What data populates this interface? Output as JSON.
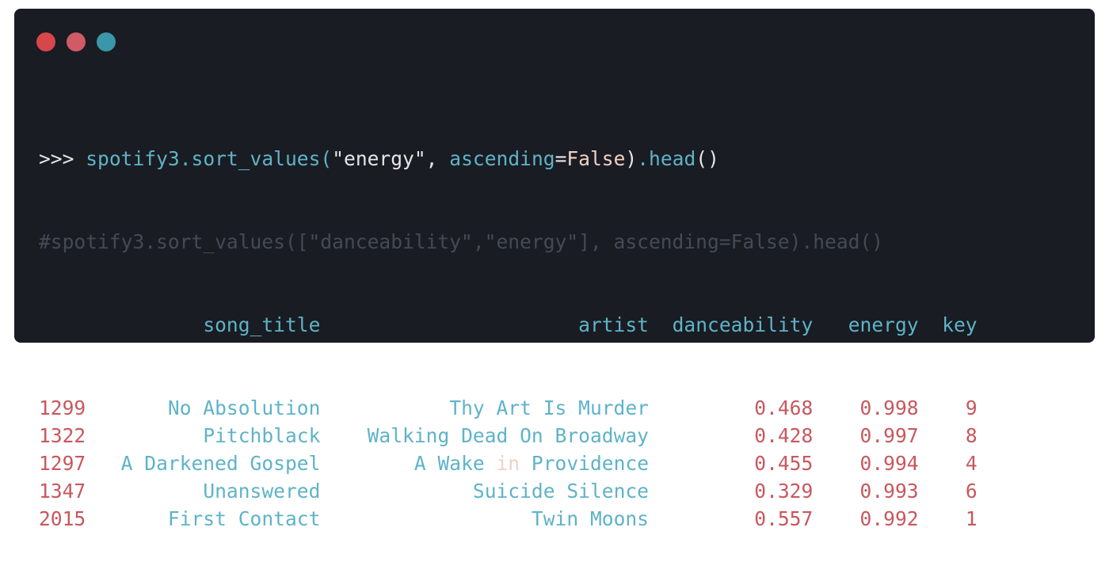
{
  "window": {
    "lights": [
      "close",
      "minimize",
      "maximize"
    ],
    "colors": {
      "close": "#d7474a",
      "minimize": "#d05a66",
      "maximize": "#3a96a8",
      "background": "#191c22"
    }
  },
  "command": {
    "prompt": ">>> ",
    "var": "spotify3",
    "method": ".sort_values(",
    "arg": "\"energy\"",
    "sep": ", ",
    "kwarg": "ascending",
    "eq": "=",
    "value": "False",
    "tail_paren": ")",
    "tail_method": ".head",
    "tail_call": "()"
  },
  "comment": "#spotify3.sort_values([\"danceability\",\"energy\"], ascending=False).head()",
  "table": {
    "columns": [
      "song_title",
      "artist",
      "danceability",
      "energy",
      "key"
    ],
    "rows": [
      {
        "index": "1299",
        "song_title": "No Absolution",
        "artist": "Thy Art Is Murder",
        "danceability": "0.468",
        "energy": "0.998",
        "key": "9"
      },
      {
        "index": "1322",
        "song_title": "Pitchblack",
        "artist": "Walking Dead On Broadway",
        "danceability": "0.428",
        "energy": "0.997",
        "key": "8"
      },
      {
        "index": "1297",
        "song_title": "A Darkened Gospel",
        "artist": "A Wake in Providence",
        "danceability": "0.455",
        "energy": "0.994",
        "key": "4"
      },
      {
        "index": "1347",
        "song_title": "Unanswered",
        "artist": "Suicide Silence",
        "danceability": "0.329",
        "energy": "0.993",
        "key": "6"
      },
      {
        "index": "2015",
        "song_title": "First Contact",
        "artist": "Twin Moons",
        "danceability": "0.557",
        "energy": "0.992",
        "key": "1"
      }
    ]
  }
}
